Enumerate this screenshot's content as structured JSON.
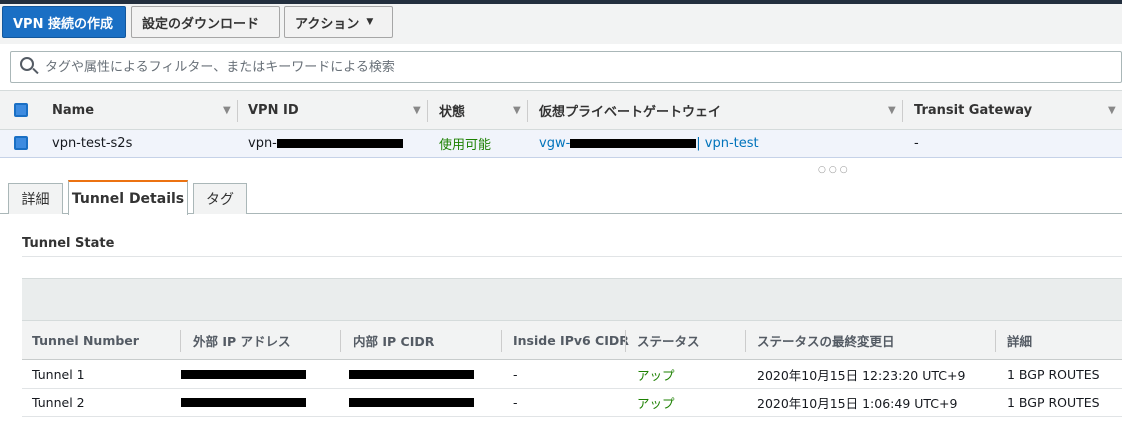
{
  "toolbar": {
    "create_label": "VPN 接続の作成",
    "download_label": "設定のダウンロード",
    "actions_label": "アクション"
  },
  "search": {
    "placeholder": "タグや属性によるフィルター、またはキーワードによる検索"
  },
  "grid": {
    "columns": [
      "Name",
      "VPN ID",
      "状態",
      "仮想プライベートゲートウェイ",
      "Transit Gateway"
    ],
    "row": {
      "name": "vpn-test-s2s",
      "vpn_id_prefix": "vpn-",
      "state": "使用可能",
      "vgw_prefix": "vgw-",
      "vgw_name": "| vpn-test",
      "transit": "-"
    }
  },
  "tabs": [
    "詳細",
    "Tunnel Details",
    "タグ"
  ],
  "tunnel_state": {
    "title": "Tunnel State",
    "columns": [
      "Tunnel Number",
      "外部 IP アドレス",
      "内部 IP CIDR",
      "Inside IPv6 CIDR",
      "ステータス",
      "ステータスの最終変更日",
      "詳細"
    ],
    "rows": [
      {
        "number": "Tunnel 1",
        "ipv6": "-",
        "status": "アップ",
        "changed": "2020年10月15日 12:23:20 UTC+9",
        "detail": "1 BGP ROUTES"
      },
      {
        "number": "Tunnel 2",
        "ipv6": "-",
        "status": "アップ",
        "changed": "2020年10月15日 1:06:49 UTC+9",
        "detail": "1 BGP ROUTES"
      }
    ]
  },
  "colors": {
    "primary": "#1a6fc4",
    "status_green": "#1d8102",
    "link": "#0073bb",
    "active_tab": "#ec7211"
  }
}
